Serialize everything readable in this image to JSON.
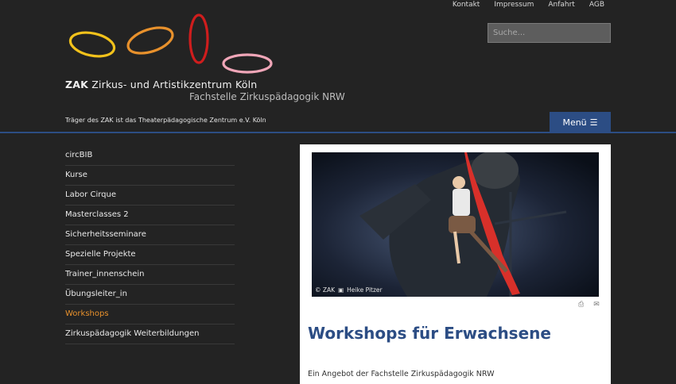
{
  "topnav": {
    "items": [
      "Kontakt",
      "Impressum",
      "Anfahrt",
      "AGB"
    ]
  },
  "search": {
    "placeholder": "Suche..."
  },
  "header": {
    "title_bold": "ZAK",
    "title_rest": " Zirkus- und Artistikzentrum Köln",
    "subtitle": "Fachstelle Zirkuspädagogik NRW",
    "traeger": "Träger des ZAK ist das Theaterpädagogische Zentrum e.V. Köln"
  },
  "menu": {
    "label": "Menü",
    "icon": "hamburger-icon"
  },
  "colors": {
    "accent_blue": "#2c4d84",
    "active_orange": "#e8912c",
    "background": "#232323"
  },
  "sidebar": {
    "items": [
      {
        "label": "circBIB",
        "active": false
      },
      {
        "label": "Kurse",
        "active": false
      },
      {
        "label": "Labor Cirque",
        "active": false
      },
      {
        "label": "Masterclasses 2",
        "active": false
      },
      {
        "label": "Sicherheitsseminare",
        "active": false
      },
      {
        "label": "Spezielle Projekte",
        "active": false
      },
      {
        "label": "Trainer_innenschein",
        "active": false
      },
      {
        "label": "Übungsleiter_in",
        "active": false
      },
      {
        "label": "Workshops",
        "active": true
      },
      {
        "label": "Zirkuspädagogik Weiterbildungen",
        "active": false
      }
    ]
  },
  "article": {
    "photo_credit_prefix": "© ZAK",
    "photo_credit_name": "Heike Pitzer",
    "title": "Workshops für Erwachsene",
    "intro": "Ein Angebot der Fachstelle Zirkuspädagogik NRW",
    "print_icon": "printer-icon",
    "email_icon": "email-icon"
  }
}
